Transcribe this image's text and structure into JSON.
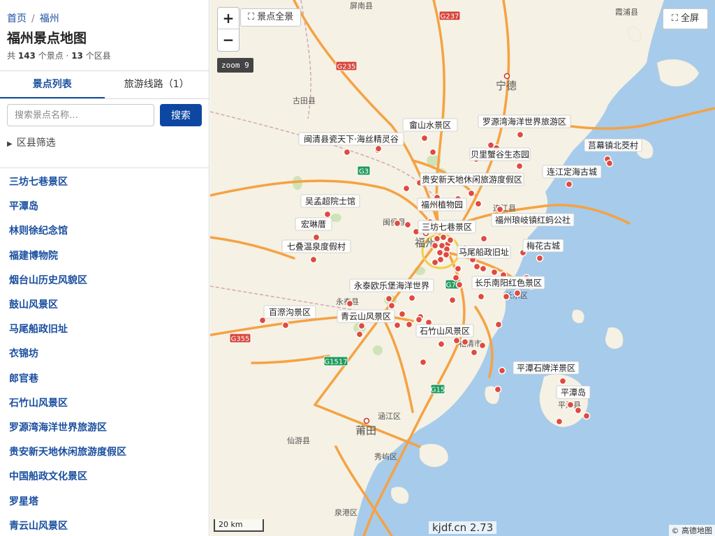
{
  "breadcrumb": {
    "home": "首页",
    "current": "福州"
  },
  "page_title": "福州景点地图",
  "stats": {
    "prefix": "共",
    "spot_count": "143",
    "spot_unit": "个景点 ·",
    "county_count": "13",
    "county_unit": "个区县"
  },
  "tabs": [
    {
      "label": "景点列表",
      "active": true
    },
    {
      "label": "旅游线路（1）",
      "active": false
    }
  ],
  "search": {
    "placeholder": "搜索景点名称…",
    "button": "搜索"
  },
  "filter_label": "区县筛选",
  "spot_list": [
    "三坊七巷景区",
    "平潭岛",
    "林则徐纪念馆",
    "福建博物院",
    "烟台山历史风貌区",
    "鼓山风景区",
    "马尾船政旧址",
    "衣锦坊",
    "郎官巷",
    "石竹山风景区",
    "罗源湾海洋世界旅游区",
    "贵安新天地休闲旅游度假区",
    "中国船政文化景区",
    "罗星塔",
    "青云山风景区"
  ],
  "map": {
    "zoom_in": "+",
    "zoom_out": "−",
    "overview_button": "⛶ 景点全景",
    "fullscreen_button": "⛶ 全屏",
    "zoom_level": "zoom 9",
    "scale_label": "20 km",
    "watermark": "kjdf.cn 2.73",
    "attribution": "© 高德地图",
    "colors": {
      "land": "#f5f1e4",
      "sea": "#a7cbea",
      "highway": "#f5a243",
      "poi_marker": "#e04a3f"
    },
    "places": [
      {
        "name": "屏南县",
        "size": "small"
      },
      {
        "name": "霞浦县",
        "size": "small"
      },
      {
        "name": "宁德",
        "size": "large"
      },
      {
        "name": "古田县",
        "size": "small"
      },
      {
        "name": "连江县",
        "size": "small"
      },
      {
        "name": "闽侯县",
        "size": "small"
      },
      {
        "name": "福州",
        "size": "large"
      },
      {
        "name": "永泰县",
        "size": "small"
      },
      {
        "name": "长乐区",
        "size": "small"
      },
      {
        "name": "福清市",
        "size": "small"
      },
      {
        "name": "平潭县",
        "size": "small"
      },
      {
        "name": "涵江区",
        "size": "small"
      },
      {
        "name": "莆田",
        "size": "large"
      },
      {
        "name": "仙游县",
        "size": "small"
      },
      {
        "name": "秀屿区",
        "size": "small"
      },
      {
        "name": "泉港区",
        "size": "small"
      }
    ],
    "road_shields": [
      {
        "name": "G237",
        "color": "red"
      },
      {
        "name": "G235",
        "color": "red"
      },
      {
        "name": "G355",
        "color": "red"
      },
      {
        "name": "G3",
        "color": "green"
      },
      {
        "name": "G70",
        "color": "green"
      },
      {
        "name": "G1517",
        "color": "green"
      },
      {
        "name": "G15",
        "color": "green"
      }
    ],
    "poi_labels": [
      "畲山水景区",
      "罗源湾海洋世界旅游区",
      "闽清县瓷天下·海丝精灵谷",
      "贝里蟹谷生态园",
      "莒幕镇北茭村",
      "连江定海古城",
      "贵安新天地休闲旅游度假区",
      "吴孟超院士馆",
      "福州植物园",
      "福州琅岐镇红蚂公社",
      "宏琳厝",
      "三坊七巷景区",
      "七叠温泉度假村",
      "梅花古城",
      "马尾船政旧址",
      "永泰欧乐堡海洋世界",
      "长乐南阳红色景区",
      "百漈沟景区",
      "青云山风景区",
      "石竹山风景区",
      "平潭石牌洋景区",
      "平潭岛"
    ]
  }
}
